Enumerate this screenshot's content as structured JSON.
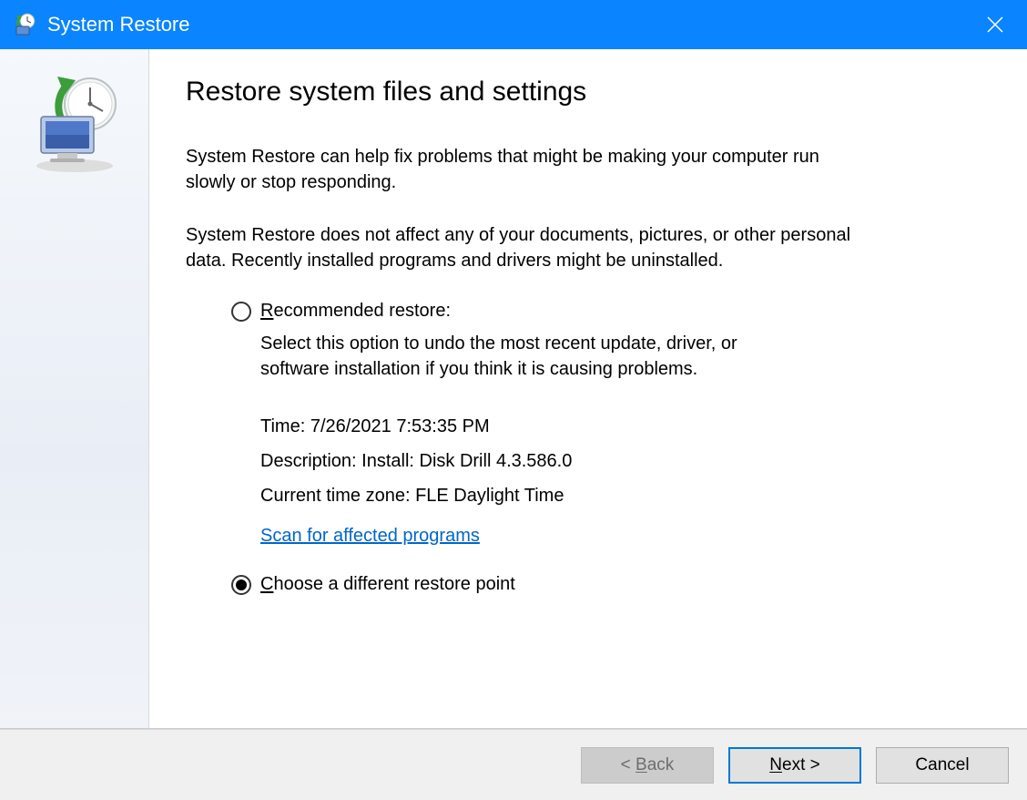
{
  "window": {
    "title": "System Restore"
  },
  "page": {
    "heading": "Restore system files and settings",
    "para1": "System Restore can help fix problems that might be making your computer run slowly or stop responding.",
    "para2": "System Restore does not affect any of your documents, pictures, or other personal data. Recently installed programs and drivers might be uninstalled."
  },
  "options": {
    "recommended": {
      "label_pre": "R",
      "label_rest": "ecommended restore:",
      "desc": "Select this option to undo the most recent update, driver, or software installation if you think it is causing problems.",
      "selected": false,
      "details": {
        "time": "Time: 7/26/2021 7:53:35 PM",
        "description": "Description: Install: Disk Drill 4.3.586.0",
        "timezone": "Current time zone: FLE Daylight Time"
      },
      "scan_link": "Scan for affected programs"
    },
    "choose": {
      "label_pre": "C",
      "label_rest": "hoose a different restore point",
      "selected": true
    }
  },
  "buttons": {
    "back": "< Back",
    "next_pre": "N",
    "next_rest": "ext >",
    "cancel": "Cancel"
  }
}
